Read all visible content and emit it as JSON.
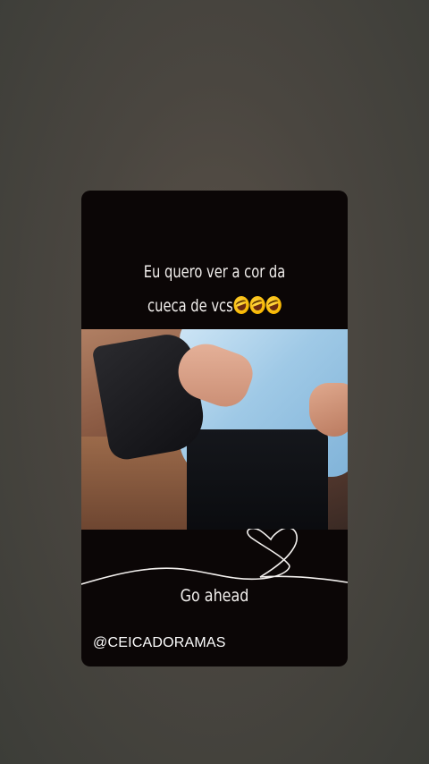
{
  "story": {
    "caption_line1": "Eu quero ver a cor da",
    "caption_line2": "cueca de vcs",
    "caption_emojis": [
      "rolling-on-floor-laughing",
      "rolling-on-floor-laughing",
      "rolling-on-floor-laughing"
    ],
    "footer_text": "Go ahead",
    "handle": "@CEICADORAMAS"
  },
  "colors": {
    "card_background": "#0b0606",
    "text": "#f3f0ee",
    "page_background": "#4a4640"
  }
}
